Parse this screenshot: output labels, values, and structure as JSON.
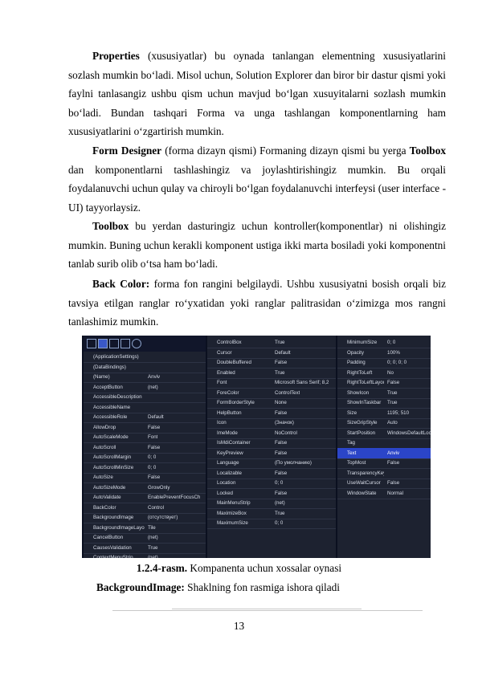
{
  "paragraphs": [
    {
      "bold": "Properties",
      "text": " (xususiyatlar) bu oynada tanlangan elementning xususiyatlarini sozlash mumkin bo‘ladi. Misol uchun, Solution Explorer dan biror bir dastur qismi yoki faylni tanlasangiz ushbu qism uchun mavjud bo‘lgan xusuyitalarni sozlash mumkin bo‘ladi. Bundan tashqari Forma va unga tashlangan komponentlarning ham xususiyatlarini o‘zgartirish mumkin."
    },
    {
      "bold": "Form Designer",
      "text": " (forma dizayn qismi) Formaning dizayn qismi bu yerga "
    },
    {
      "bold": "Toolbox",
      "text": " bu yerdan dasturingiz uchun kontroller(komponentlar) ni olishingiz mumkin. Buning uchun kerakli komponent ustiga ikki marta bosiladi yoki komponentni tanlab surib olib o‘tsa ham bo‘ladi."
    },
    {
      "bold": "Back Color:",
      "text": " forma fon rangini belgilaydi. Ushbu xususiyatni bosish orqali biz tavsiya etilgan ranglar ro‘yxatidan yoki ranglar palitrasidan o‘zimizga mos rangni tanlashimiz mumkin."
    }
  ],
  "para2_tail_bold": "Toolbox",
  "para2_tail_text": " dan komponentlarni tashlashingiz va joylashtirishingiz mumkin. Bu orqali foydalanuvchi uchun qulay va chiroyli bo‘lgan foydalanuvchi interfeysi (user interface - UI) tayyorlaysiz.",
  "figure": {
    "panel1": [
      [
        "(ApplicationSettings)",
        ""
      ],
      [
        "(DataBindings)",
        ""
      ],
      [
        "(Name)",
        "Anviv"
      ],
      [
        "AcceptButton",
        "(net)"
      ],
      [
        "AccessibleDescription",
        ""
      ],
      [
        "AccessibleName",
        ""
      ],
      [
        "AccessibleRole",
        "Default"
      ],
      [
        "AllowDrop",
        "False"
      ],
      [
        "AutoScaleMode",
        "Font"
      ],
      [
        "AutoScroll",
        "False"
      ],
      [
        "AutoScrollMargin",
        "0; 0"
      ],
      [
        "AutoScrollMinSize",
        "0; 0"
      ],
      [
        "AutoSize",
        "False"
      ],
      [
        "AutoSizeMode",
        "GrowOnly"
      ],
      [
        "AutoValidate",
        "EnablePreventFocusCh"
      ],
      [
        "BackColor",
        "Control"
      ],
      [
        "BackgroundImage",
        "(отсутствует)"
      ],
      [
        "BackgroundImageLayo",
        "Tile"
      ],
      [
        "CancelButton",
        "(net)"
      ],
      [
        "CausesValidation",
        "True"
      ],
      [
        "ContextMenuStrip",
        "(net)"
      ]
    ],
    "panel2": [
      [
        "ControlBox",
        "True"
      ],
      [
        "Cursor",
        "Default"
      ],
      [
        "DoubleBuffered",
        "False"
      ],
      [
        "Enabled",
        "True"
      ],
      [
        "Font",
        "Microsoft Sans Serif; 8,2"
      ],
      [
        "ForeColor",
        "ControlText"
      ],
      [
        "FormBorderStyle",
        "None"
      ],
      [
        "HelpButton",
        "False"
      ],
      [
        "Icon",
        "(Значок)"
      ],
      [
        "ImeMode",
        "NoControl"
      ],
      [
        "IsMdiContainer",
        "False"
      ],
      [
        "KeyPreview",
        "False"
      ],
      [
        "Language",
        "(По умолчанию)"
      ],
      [
        "Localizable",
        "False"
      ],
      [
        "Location",
        "0; 0"
      ],
      [
        "Locked",
        "False"
      ],
      [
        "MainMenuStrip",
        "(net)"
      ],
      [
        "MaximizeBox",
        "True"
      ],
      [
        "MaximumSize",
        "0; 0"
      ]
    ],
    "panel3": [
      [
        "MinimumSize",
        "0; 0"
      ],
      [
        "Opacity",
        "100%"
      ],
      [
        "Padding",
        "0; 0; 0; 0"
      ],
      [
        "RightToLeft",
        "No"
      ],
      [
        "RightToLeftLayout",
        "False"
      ],
      [
        "ShowIcon",
        "True"
      ],
      [
        "ShowInTaskbar",
        "True"
      ],
      [
        "Size",
        "1195; 510"
      ],
      [
        "SizeGripStyle",
        "Auto"
      ],
      [
        "StartPosition",
        "WindowsDefaultLocati"
      ],
      [
        "Tag",
        ""
      ],
      [
        "Text",
        "Anviv"
      ],
      [
        "TopMost",
        "False"
      ],
      [
        "TransparencyKey",
        ""
      ],
      [
        "UseWaitCursor",
        "False"
      ],
      [
        "WindowState",
        "Normal"
      ]
    ]
  },
  "caption_bold": "1.2.4-rasm.",
  "caption_text": " Kompanenta uchun xossalar oynasi",
  "bgimage_bold": "BackgroundImage:",
  "bgimage_text": " Shaklning fon rasmiga ishora qiladi",
  "page_number": "13"
}
